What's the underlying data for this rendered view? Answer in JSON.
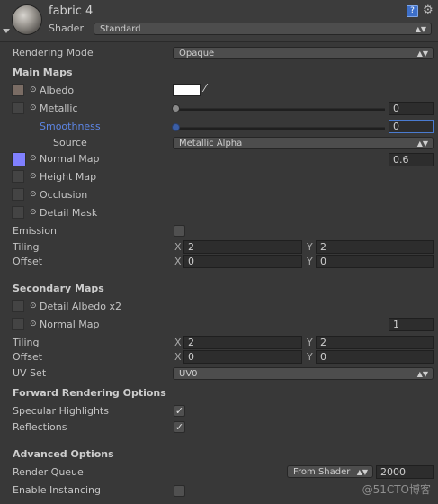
{
  "header": {
    "material_name": "fabric 4",
    "shader_label": "Shader",
    "shader_value": "Standard",
    "help_icon_text": "?"
  },
  "rendering_mode": {
    "label": "Rendering Mode",
    "value": "Opaque"
  },
  "main_maps": {
    "title": "Main Maps",
    "albedo": {
      "label": "Albedo",
      "swatch_color": "#7a6c64",
      "color_value": "#ffffff"
    },
    "metallic": {
      "label": "Metallic",
      "value": "0",
      "slider_fraction": 0
    },
    "smoothness": {
      "label": "Smoothness",
      "value": "0",
      "slider_fraction": 0,
      "label_color": "#5d86e5"
    },
    "source": {
      "label": "Source",
      "value": "Metallic Alpha"
    },
    "normal_map": {
      "label": "Normal Map",
      "value": "0.6",
      "swatch_color": "#8080ff"
    },
    "height_map": {
      "label": "Height Map"
    },
    "occlusion": {
      "label": "Occlusion"
    },
    "detail_mask": {
      "label": "Detail Mask"
    },
    "emission": {
      "label": "Emission",
      "checked": false
    },
    "tiling": {
      "label": "Tiling",
      "x_label": "X",
      "y_label": "Y",
      "x": "2",
      "y": "2"
    },
    "offset": {
      "label": "Offset",
      "x_label": "X",
      "y_label": "Y",
      "x": "0",
      "y": "0"
    }
  },
  "secondary_maps": {
    "title": "Secondary Maps",
    "detail_albedo": {
      "label": "Detail Albedo x2"
    },
    "normal_map": {
      "label": "Normal Map",
      "value": "1"
    },
    "tiling": {
      "label": "Tiling",
      "x_label": "X",
      "y_label": "Y",
      "x": "2",
      "y": "2"
    },
    "offset": {
      "label": "Offset",
      "x_label": "X",
      "y_label": "Y",
      "x": "0",
      "y": "0"
    },
    "uv_set": {
      "label": "UV Set",
      "value": "UV0"
    }
  },
  "forward_rendering": {
    "title": "Forward Rendering Options",
    "specular_highlights": {
      "label": "Specular Highlights",
      "checked": true
    },
    "reflections": {
      "label": "Reflections",
      "checked": true
    }
  },
  "advanced": {
    "title": "Advanced Options",
    "render_queue": {
      "label": "Render Queue",
      "mode": "From Shader",
      "value": "2000"
    },
    "enable_instancing": {
      "label": "Enable Instancing",
      "checked": false
    }
  },
  "watermark": "@51CTO博客",
  "icons": {
    "material_preview": "sphere-thumbnail",
    "fold": "foldout-arrow-icon",
    "help": "help-book-icon",
    "settings": "gear-icon",
    "eyedropper": "eyedropper-icon",
    "checkmark": "checkmark-icon"
  }
}
